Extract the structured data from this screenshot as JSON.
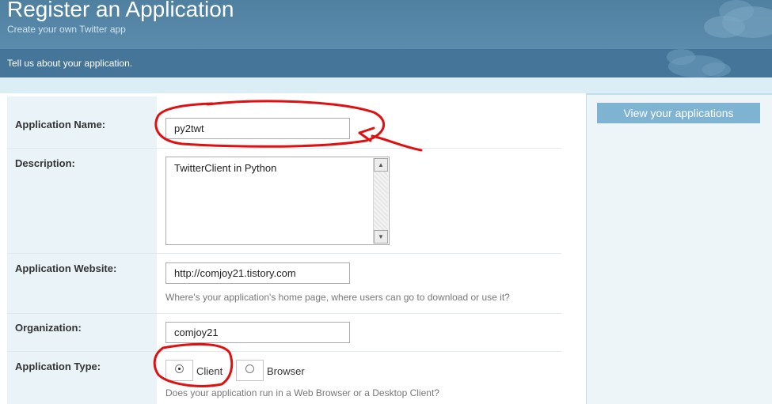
{
  "header": {
    "title": "Register an Application",
    "subtitle": "Create your own Twitter app"
  },
  "subheader": {
    "text": "Tell us about your application."
  },
  "sidebar": {
    "view_apps_label": "View your applications"
  },
  "form": {
    "app_name": {
      "label": "Application Name:",
      "value": "py2twt"
    },
    "description": {
      "label": "Description:",
      "value": "TwitterClient in Python"
    },
    "website": {
      "label": "Application Website:",
      "value": "http://comjoy21.tistory.com",
      "help": "Where's your application's home page, where users can go to download or use it?"
    },
    "organization": {
      "label": "Organization:",
      "value": "comjoy21"
    },
    "app_type": {
      "label": "Application Type:",
      "options": [
        {
          "label": "Client",
          "selected": true
        },
        {
          "label": "Browser",
          "selected": false
        }
      ],
      "help": "Does your application run in a Web Browser or a Desktop Client?"
    }
  },
  "colors": {
    "header": "#5b8cad",
    "subheader": "#45769a",
    "button": "#7eb4d2",
    "annotation": "#e01010"
  }
}
